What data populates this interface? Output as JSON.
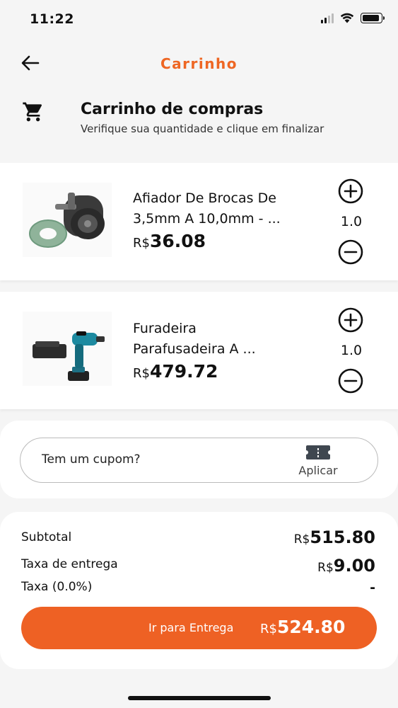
{
  "status_bar": {
    "time": "11:22"
  },
  "header": {
    "title": "Carrinho",
    "back_icon": "arrow-left-icon"
  },
  "section": {
    "icon": "shopping-cart-icon",
    "title": "Carrinho de compras",
    "subtitle": "Verifique sua quantidade e clique em finalizar"
  },
  "cart": {
    "items": [
      {
        "name_line1": "Afiador De Brocas De",
        "name_line2": "3,5mm A 10,0mm - ...",
        "currency": "R$",
        "price": "36.08",
        "quantity": "1.0"
      },
      {
        "name_line1": "Furadeira",
        "name_line2": "Parafusadeira A ...",
        "currency": "R$",
        "price": "479.72",
        "quantity": "1.0"
      }
    ]
  },
  "coupon": {
    "placeholder": "Tem um cupom?",
    "apply_label": "Aplicar",
    "icon": "ticket-icon"
  },
  "summary": {
    "subtotal_label": "Subtotal",
    "subtotal_currency": "R$",
    "subtotal_value": "515.80",
    "delivery_label": "Taxa de entrega",
    "delivery_currency": "R$",
    "delivery_value": "9.00",
    "tax_label": "Taxa (0.0%)",
    "tax_value": "-"
  },
  "checkout": {
    "label": "Ir para Entrega",
    "currency": "R$",
    "total": "524.80"
  },
  "colors": {
    "accent": "#ee6124",
    "title_orange": "#ee6623",
    "background": "#f5f5f5",
    "card": "#ffffff"
  }
}
